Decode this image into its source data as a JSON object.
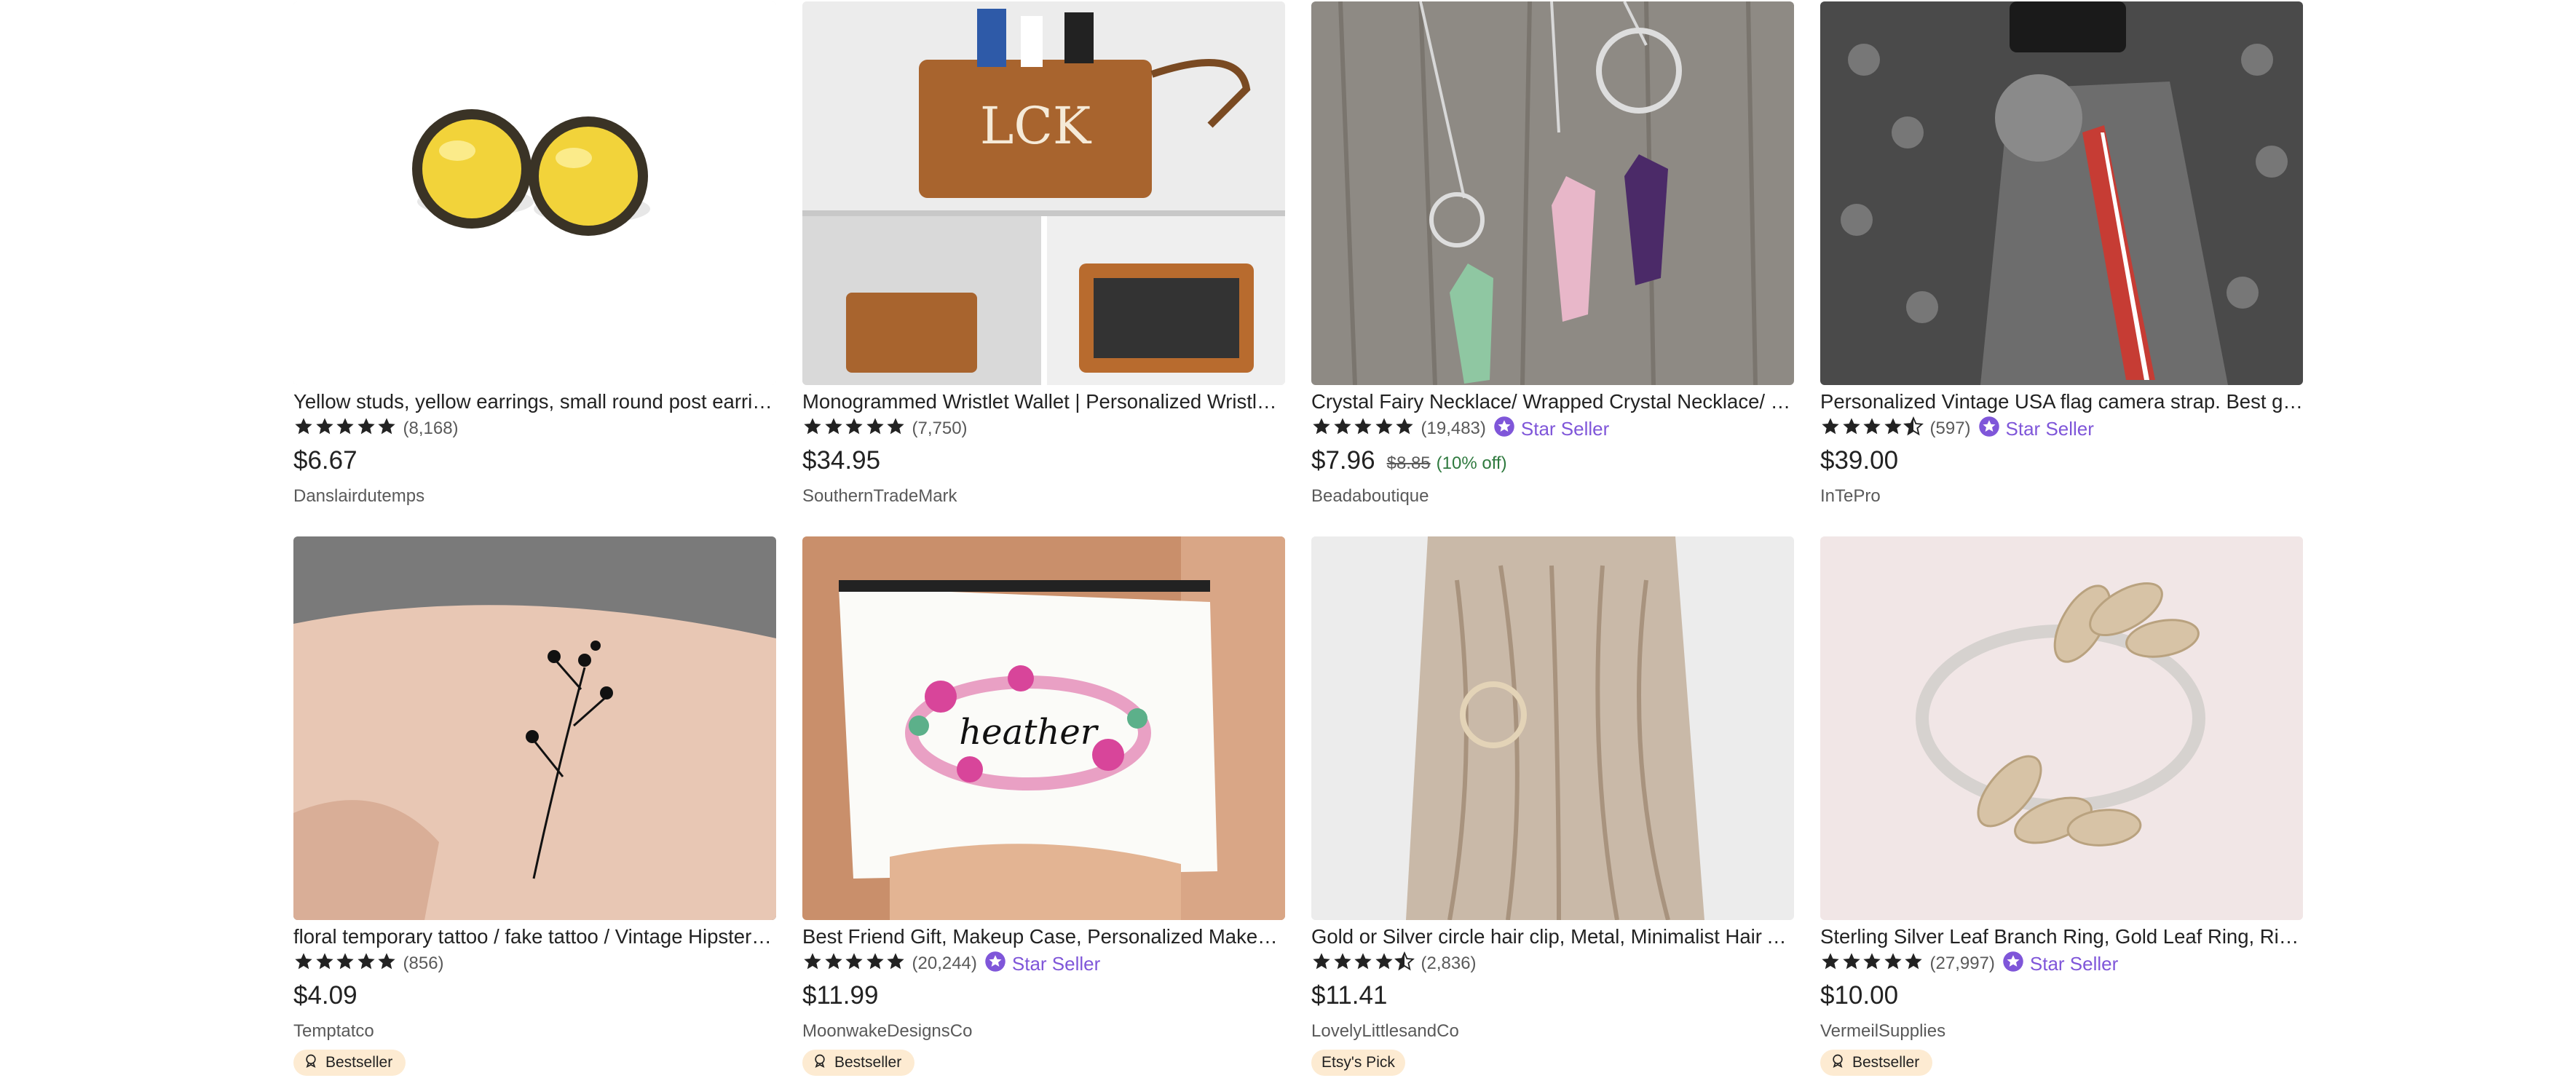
{
  "listings": [
    {
      "title": "Yellow studs, yellow earrings, small round post earrings",
      "rating": 5,
      "reviews": "(8,168)",
      "star_seller": "",
      "price": "$6.67",
      "original_price": "",
      "discount": "",
      "shop": "Danslairdutemps",
      "badge": "",
      "image": "yellow-stud-earrings-photo"
    },
    {
      "title": "Monogrammed Wristlet Wallet | Personalized Wristlet Wallet",
      "rating": 5,
      "reviews": "(7,750)",
      "star_seller": "",
      "price": "$34.95",
      "original_price": "",
      "discount": "",
      "shop": "SouthernTradeMark",
      "badge": "",
      "image": "monogram-wristlet-photo"
    },
    {
      "title": "Crystal Fairy Necklace/ Wrapped Crystal Necklace/ Pendant",
      "rating": 5,
      "reviews": "(19,483)",
      "star_seller": "Star Seller",
      "price": "$7.96",
      "original_price": "$8.85",
      "discount": "(10% off)",
      "shop": "Beadaboutique",
      "badge": "",
      "image": "crystal-necklaces-photo"
    },
    {
      "title": "Personalized Vintage USA flag camera strap. Best gift for photographers",
      "rating": 4.5,
      "reviews": "(597)",
      "star_seller": "Star Seller",
      "price": "$39.00",
      "original_price": "",
      "discount": "",
      "shop": "InTePro",
      "badge": "",
      "image": "camera-strap-photo"
    },
    {
      "title": "floral temporary tattoo / fake tattoo / Vintage Hipster tattoo",
      "rating": 5,
      "reviews": "(856)",
      "star_seller": "",
      "price": "$4.09",
      "original_price": "",
      "discount": "",
      "shop": "Temptatco",
      "badge": "Bestseller",
      "image": "floral-tattoo-photo"
    },
    {
      "title": "Best Friend Gift, Makeup Case, Personalized Makeup Bag",
      "rating": 5,
      "reviews": "(20,244)",
      "star_seller": "Star Seller",
      "price": "$11.99",
      "original_price": "",
      "discount": "",
      "shop": "MoonwakeDesignsCo",
      "badge": "Bestseller",
      "image": "makeup-bag-photo"
    },
    {
      "title": "Gold or Silver circle hair clip, Metal, Minimalist Hair Accessories",
      "rating": 4.5,
      "reviews": "(2,836)",
      "star_seller": "",
      "price": "$11.41",
      "original_price": "",
      "discount": "",
      "shop": "LovelyLittlesandCo",
      "badge": "Etsy's Pick",
      "image": "hair-clip-photo"
    },
    {
      "title": "Sterling Silver Leaf Branch Ring, Gold Leaf Ring, Ring for Women",
      "rating": 5,
      "reviews": "(27,997)",
      "star_seller": "Star Seller",
      "price": "$10.00",
      "original_price": "",
      "discount": "",
      "shop": "VermeilSupplies",
      "badge": "Bestseller",
      "image": "leaf-ring-photo"
    }
  ],
  "colors": {
    "star": "#222222",
    "star_seller": "#7f56d9",
    "discount": "#2f7a3f",
    "badge_bg": "#fdebd2"
  }
}
